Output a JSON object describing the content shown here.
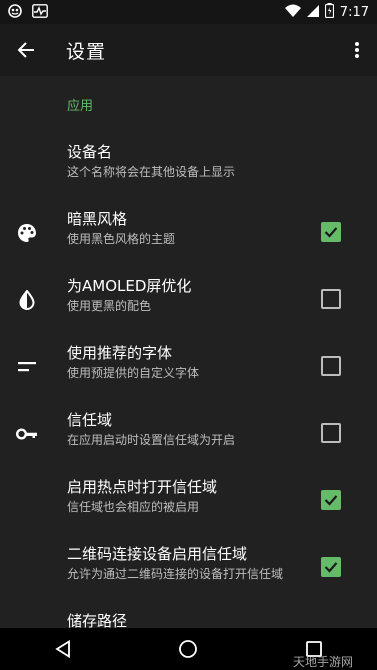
{
  "status": {
    "time": "7:17"
  },
  "appbar": {
    "title": "设置"
  },
  "section": {
    "app": "应用"
  },
  "items": [
    {
      "title": "设备名",
      "subtitle": "这个名称将会在其他设备上显示"
    },
    {
      "title": "暗黑风格",
      "subtitle": "使用黑色风格的主题",
      "checked": true
    },
    {
      "title": "为AMOLED屏优化",
      "subtitle": "使用更黑的配色",
      "checked": false
    },
    {
      "title": "使用推荐的字体",
      "subtitle": "使用预提供的自定义字体",
      "checked": false
    },
    {
      "title": "信任域",
      "subtitle": "在应用启动时设置信任域为开启",
      "checked": false
    },
    {
      "title": "启用热点时打开信任域",
      "subtitle": "信任域也会相应的被启用",
      "checked": true
    },
    {
      "title": "二维码连接设备启用信任域",
      "subtitle": "允许为通过二维码连接的设备打开信任域",
      "checked": true
    },
    {
      "title": "储存路径",
      "subtitle": ""
    }
  ],
  "watermark": "天地手游网",
  "colors": {
    "accent": "#66bb6a",
    "background": "#212121"
  },
  "icons": [
    "palette-icon",
    "contrast-icon",
    "font-icon",
    "key-icon",
    "storage-icon"
  ]
}
